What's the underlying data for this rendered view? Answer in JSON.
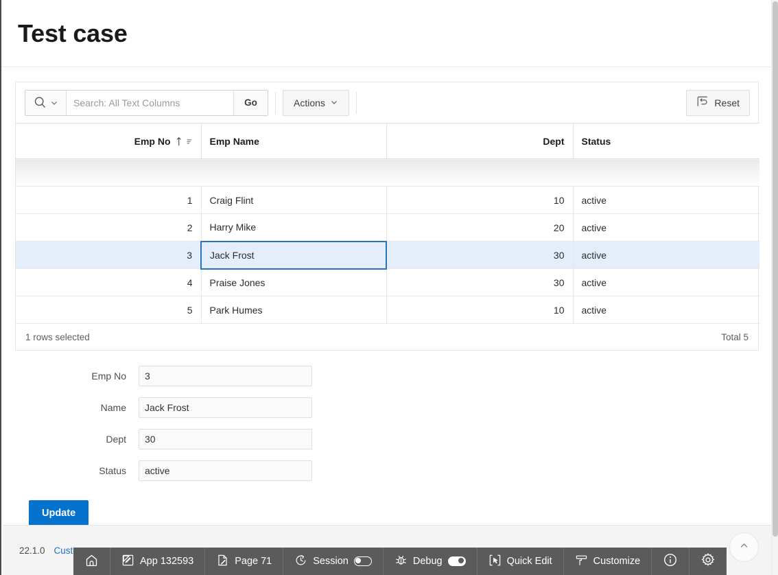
{
  "page": {
    "title": "Test case",
    "version": "22.1.0",
    "footer_link": "Custo"
  },
  "report": {
    "search": {
      "placeholder": "Search: All Text Columns",
      "value": "",
      "search_icon": "magnifier-icon",
      "dropdown_icon": "chevron-down-icon",
      "go_label": "Go"
    },
    "actions_label": "Actions",
    "reset_label": "Reset",
    "reset_icon": "undo-box-icon",
    "columns": [
      {
        "label": "Emp No",
        "align": "right",
        "sorted": true,
        "sort_dir": "asc"
      },
      {
        "label": "Emp Name",
        "align": "left",
        "sorted": false
      },
      {
        "label": "Dept",
        "align": "right",
        "sorted": false
      },
      {
        "label": "Status",
        "align": "left",
        "sorted": false
      }
    ],
    "rows": [
      {
        "emp_no": "1",
        "emp_name": "Craig Flint",
        "dept": "10",
        "status": "active",
        "selected": false
      },
      {
        "emp_no": "2",
        "emp_name": "Harry Mike",
        "dept": "20",
        "status": "active",
        "selected": false
      },
      {
        "emp_no": "3",
        "emp_name": "Jack Frost",
        "dept": "30",
        "status": "active",
        "selected": true
      },
      {
        "emp_no": "4",
        "emp_name": "Praise Jones",
        "dept": "30",
        "status": "active",
        "selected": false
      },
      {
        "emp_no": "5",
        "emp_name": "Park Humes",
        "dept": "10",
        "status": "active",
        "selected": false
      }
    ],
    "footer": {
      "selected_text": "1 rows selected",
      "total_text": "Total 5"
    }
  },
  "form": {
    "fields": [
      {
        "label": "Emp No",
        "value": "3"
      },
      {
        "label": "Name",
        "value": "Jack Frost"
      },
      {
        "label": "Dept",
        "value": "30"
      },
      {
        "label": "Status",
        "value": "active"
      }
    ],
    "submit_label": "Update",
    "submit_color": "#0572ce"
  },
  "dev_toolbar": {
    "items": [
      {
        "label": "",
        "icon": "home-icon",
        "toggle": null
      },
      {
        "label": "App 132593",
        "icon": "edit-square-icon",
        "toggle": null
      },
      {
        "label": "Page 71",
        "icon": "page-edit-icon",
        "toggle": null
      },
      {
        "label": "Session",
        "icon": "clock-icon",
        "toggle": "off"
      },
      {
        "label": "Debug",
        "icon": "bug-icon",
        "toggle": "on"
      },
      {
        "label": "Quick Edit",
        "icon": "cursor-select-icon",
        "toggle": null
      },
      {
        "label": "Customize",
        "icon": "paint-roller-icon",
        "toggle": null
      },
      {
        "label": "",
        "icon": "info-circle-icon",
        "toggle": null
      },
      {
        "label": "",
        "icon": "gear-icon",
        "toggle": null
      }
    ]
  },
  "back_to_top": {
    "icon": "chevron-up-icon"
  },
  "colors": {
    "accent": "#0572ce",
    "selected_row": "#e4eefa",
    "focus_border": "#2a74bc",
    "toolbar_bg": "#5b5b5b",
    "link": "#1e6ec8"
  }
}
